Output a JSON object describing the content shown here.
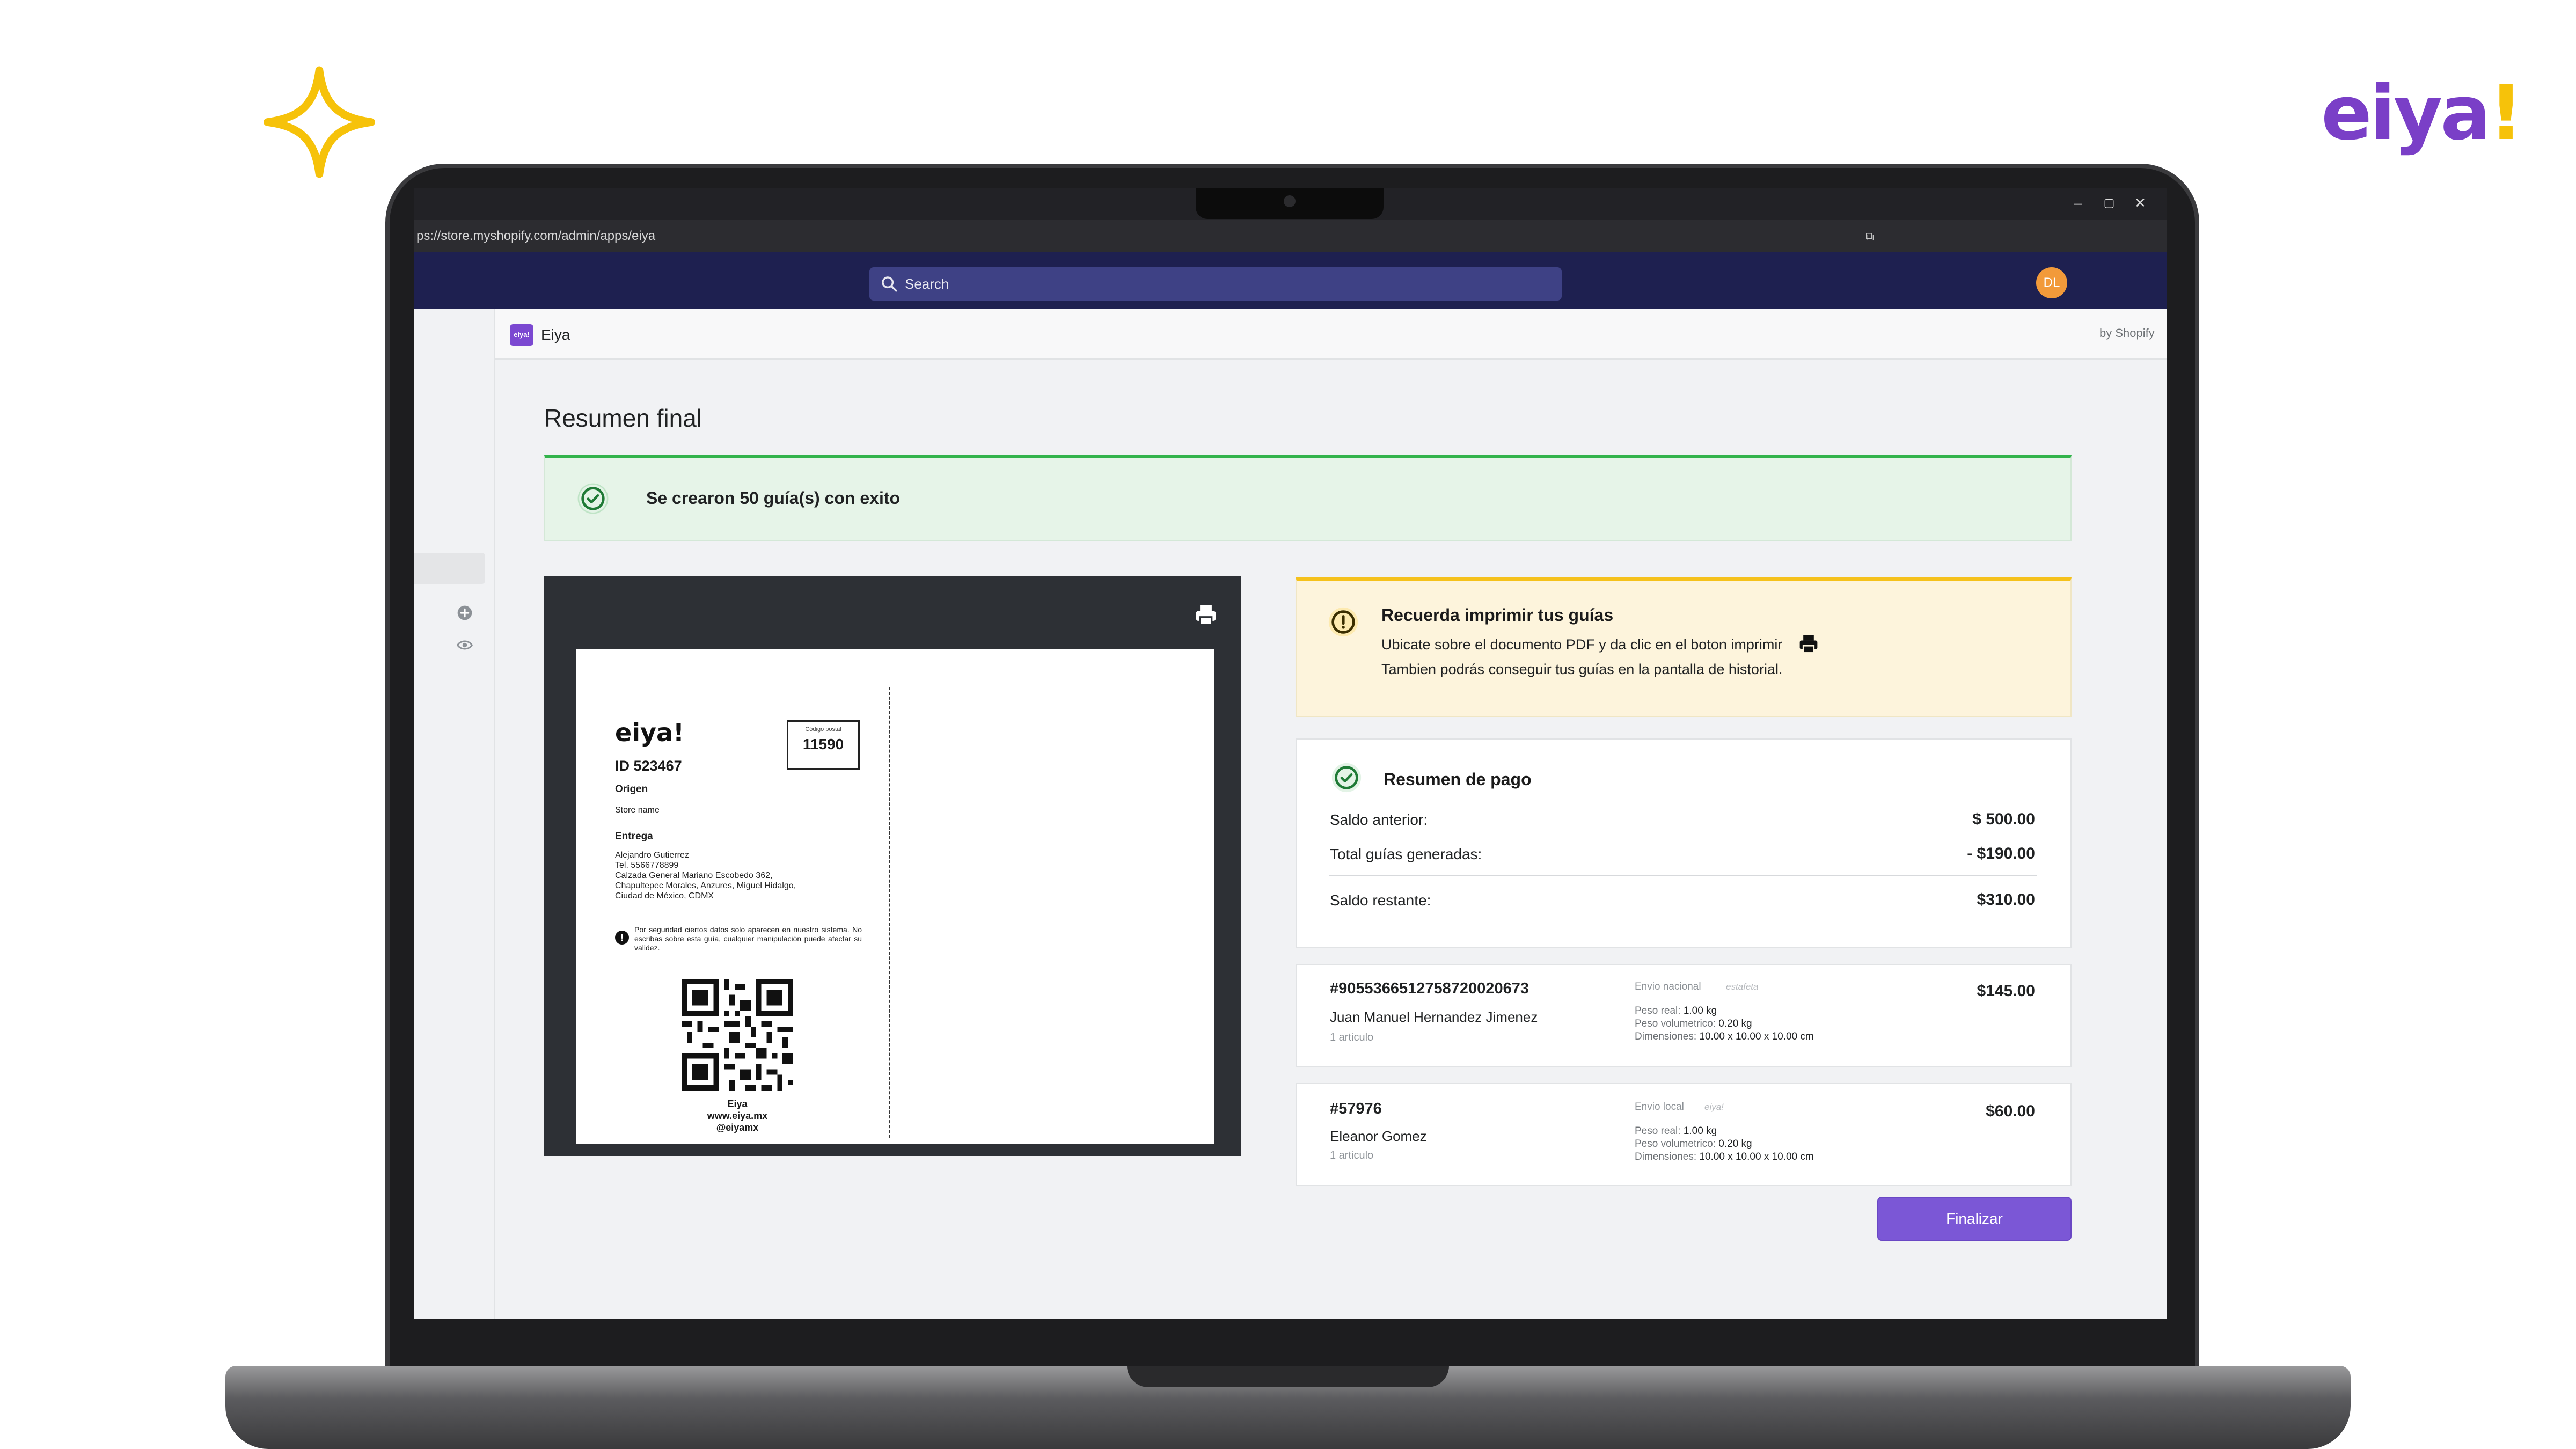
{
  "brand": {
    "logo_text": "eiya",
    "logo_bang": "!"
  },
  "browser": {
    "url": "ps://store.myshopify.com/admin/apps/eiya",
    "window_controls": [
      "–",
      "▢",
      "✕"
    ]
  },
  "shopify": {
    "search_placeholder": "Search",
    "avatar_initials": "DL",
    "app_icon_text": "eiya!",
    "app_name": "Eiya",
    "by_shopify": "by Shopify"
  },
  "page": {
    "title": "Resumen final",
    "success_message": "Se crearon 50 guía(s) con exito"
  },
  "label": {
    "logo": "eiya!",
    "id": "ID 523467",
    "postal_label": "Código postal",
    "postal_code": "11590",
    "origin_head": "Origen",
    "store_name": "Store name",
    "delivery_head": "Entrega",
    "delivery_lines": [
      "Alejandro Gutierrez",
      "Tel. 5566778899",
      "Calzada General Mariano Escobedo 362,",
      "Chapultepec Morales, Anzures, Miguel Hidalgo,",
      "Ciudad de México, CDMX"
    ],
    "security_note": "Por seguridad ciertos datos solo aparecen en nuestro sistema. No escribas sobre esta guía, cualquier manipulación puede afectar su validez.",
    "footer_lines": [
      "Eiya",
      "www.eiya.mx",
      "@eiyamx"
    ]
  },
  "reminder": {
    "title": "Recuerda imprimir tus guías",
    "line1": "Ubicate sobre el documento PDF y da clic en el boton imprimir",
    "line2": "Tambien podrás conseguir tus guías en la pantalla de historial."
  },
  "payment": {
    "title": "Resumen de pago",
    "rows": [
      {
        "label": "Saldo anterior:",
        "value": "$ 500.00"
      },
      {
        "label": "Total guías generadas:",
        "value": "- $190.00"
      },
      {
        "label": "Saldo restante:",
        "value": "$310.00"
      }
    ]
  },
  "shipments": [
    {
      "order": "#9055366512758720020673",
      "customer": "Juan Manuel Hernandez Jimenez",
      "items": "1 articulo",
      "service": "Envio nacional",
      "carrier": "estafeta",
      "real_weight_label": "Peso real:",
      "real_weight": "1.00 kg",
      "vol_weight_label": "Peso volumetrico:",
      "vol_weight": "0.20 kg",
      "dims_label": "Dimensiones:",
      "dims": "10.00 x 10.00 x 10.00 cm",
      "price": "$145.00"
    },
    {
      "order": "#57976",
      "customer": "Eleanor Gomez",
      "items": "1 articulo",
      "service": "Envio local",
      "carrier": "eiya!",
      "real_weight_label": "Peso real:",
      "real_weight": "1.00 kg",
      "vol_weight_label": "Peso volumetrico:",
      "vol_weight": "0.20 kg",
      "dims_label": "Dimensiones:",
      "dims": "10.00 x 10.00 x 10.00 cm",
      "price": "$60.00"
    }
  ],
  "actions": {
    "finalize_label": "Finalizar"
  },
  "colors": {
    "brand_purple": "#7a3fc7",
    "brand_yellow": "#f6c20a",
    "success_green": "#32b34b",
    "warning_yellow": "#f5c11b",
    "topbar_navy": "#1e2050",
    "primary_button": "#7b57d6"
  },
  "icons": [
    "sparkle-icon",
    "search-icon",
    "print-icon",
    "check-circle-icon",
    "warning-circle-icon",
    "plus-circle-icon",
    "eye-icon",
    "info-icon",
    "qr-code"
  ]
}
